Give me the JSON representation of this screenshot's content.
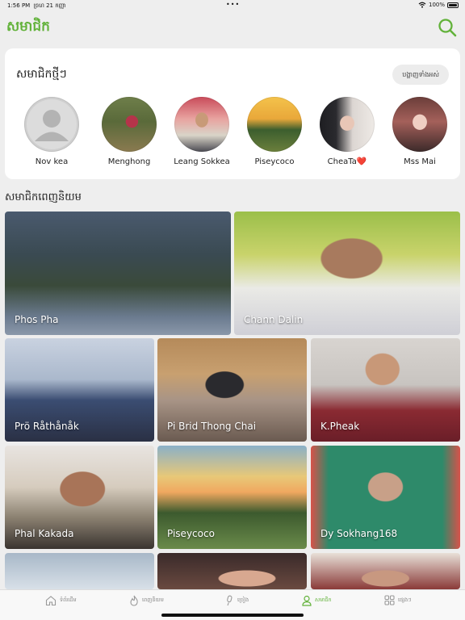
{
  "status_bar": {
    "time": "1:56 PM",
    "date": "ច្រហ 21 កញ្ញា",
    "battery": "100%"
  },
  "header": {
    "title": "សមាជិក",
    "accent_color": "#62b23a"
  },
  "new_members": {
    "title": "សមាជិកថ្មីៗ",
    "see_all_label": "បង្ហាញទាំងអស់",
    "items": [
      {
        "name": "Nov kea",
        "avatar": "placeholder"
      },
      {
        "name": "Menghong",
        "avatar": "photo"
      },
      {
        "name": "Leang Sokkea",
        "avatar": "photo"
      },
      {
        "name": "Piseycoco",
        "avatar": "photo"
      },
      {
        "name": "CheaTa❤️",
        "avatar": "photo"
      },
      {
        "name": "Mss Mai",
        "avatar": "photo"
      }
    ]
  },
  "popular": {
    "title": "សមាជិកពេញនិយម",
    "items": [
      {
        "name": "Phos Pha"
      },
      {
        "name": "Chann Dalin"
      },
      {
        "name": "Prö Råthånåk"
      },
      {
        "name": "Pi Brid Thong Chai"
      },
      {
        "name": "K.Pheak"
      },
      {
        "name": "Phal Kakada"
      },
      {
        "name": "Piseycoco"
      },
      {
        "name": "Dy Sokhang168"
      },
      {
        "name": ""
      },
      {
        "name": ""
      },
      {
        "name": ""
      }
    ]
  },
  "tabs": [
    {
      "label": "ទំព័រដើម",
      "icon": "home-icon"
    },
    {
      "label": "ពេញនិយម",
      "icon": "flame-icon"
    },
    {
      "label": "ច្រៀង",
      "icon": "microphone-icon"
    },
    {
      "label": "សមាជិក",
      "icon": "person-icon",
      "active": true
    },
    {
      "label": "ផ្សេងៗ",
      "icon": "grid-icon"
    }
  ]
}
